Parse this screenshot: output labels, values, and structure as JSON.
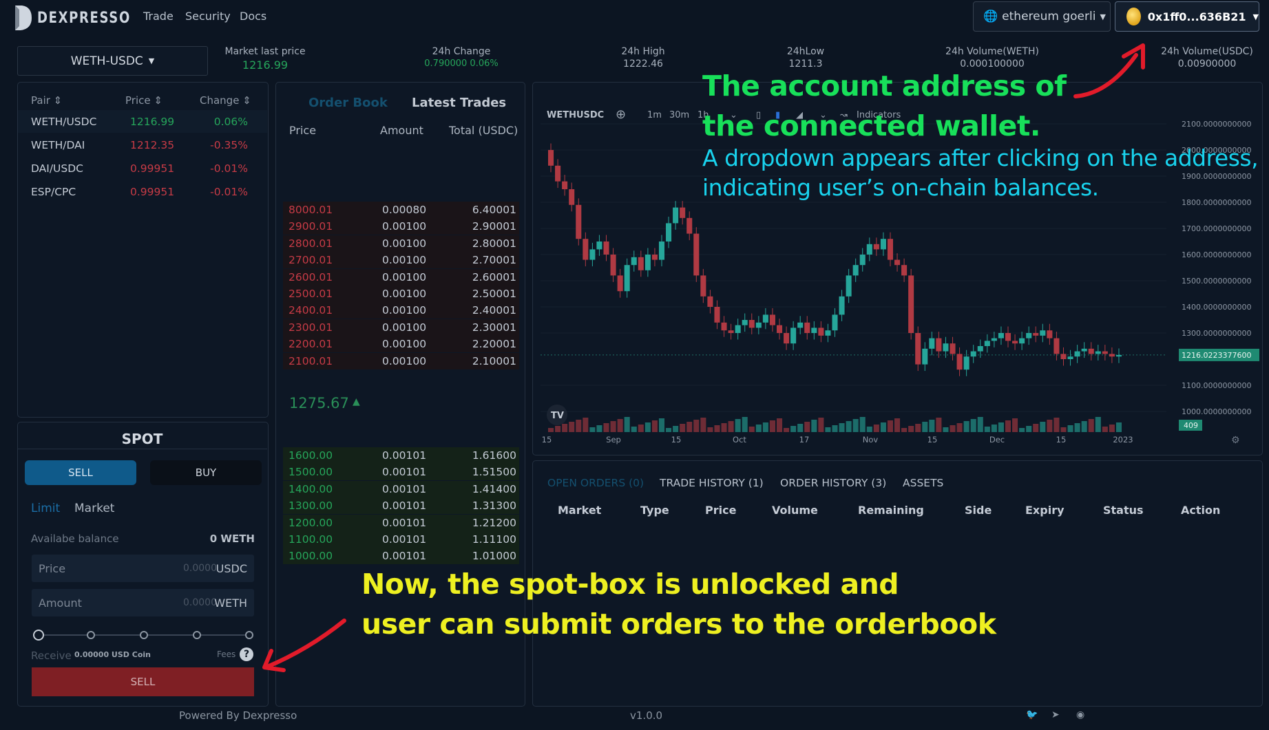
{
  "header": {
    "logo_text": "DEXPRESSO",
    "nav": [
      "Trade",
      "Security",
      "Docs"
    ],
    "network_label": "ethereum goerli",
    "account_label": "0x1ff0...636B21"
  },
  "market": {
    "pair": "WETH-USDC",
    "stats": [
      {
        "label": "Market last price",
        "value": "1216.99"
      },
      {
        "label": "24h Change",
        "value": "0.790000 0.06%"
      },
      {
        "label": "24h High",
        "value": "1222.46"
      },
      {
        "label": "24hLow",
        "value": "1211.3"
      },
      {
        "label": "24h Volume(WETH)",
        "value": "0.000100000"
      },
      {
        "label": "24h Volume(USDC)",
        "value": "0.00900000"
      }
    ]
  },
  "pairs": {
    "headers": [
      "Pair",
      "Price",
      "Change"
    ],
    "rows": [
      {
        "pair": "WETH/USDC",
        "price": "1216.99",
        "change": "0.06%"
      },
      {
        "pair": "WETH/DAI",
        "price": "1212.35",
        "change": "-0.35%"
      },
      {
        "pair": "DAI/USDC",
        "price": "0.99951",
        "change": "-0.01%"
      },
      {
        "pair": "ESP/CPC",
        "price": "0.99951",
        "change": "-0.01%"
      }
    ]
  },
  "spot": {
    "title": "SPOT",
    "sell_tab": "SELL",
    "buy_tab": "BUY",
    "limit": "Limit",
    "market": "Market",
    "balance_label": "Availabe balance",
    "balance_value": "0 WETH",
    "price_label": "Price",
    "price_value": "0.0000",
    "price_unit": "USDC",
    "amount_label": "Amount",
    "amount_value": "0.0000",
    "amount_unit": "WETH",
    "receive_label": "Receive",
    "receive_value": "0.00000 USD Coin",
    "fees_label": "Fees",
    "submit_label": "SELL"
  },
  "orderbook": {
    "tabs": [
      "Order Book",
      "Latest Trades"
    ],
    "headers": [
      "Price",
      "Amount",
      "Total (USDC)"
    ],
    "asks": [
      [
        "8000.01",
        "0.00080",
        "6.40001"
      ],
      [
        "2900.01",
        "0.00100",
        "2.90001"
      ],
      [
        "2800.01",
        "0.00100",
        "2.80001"
      ],
      [
        "2700.01",
        "0.00100",
        "2.70001"
      ],
      [
        "2600.01",
        "0.00100",
        "2.60001"
      ],
      [
        "2500.01",
        "0.00100",
        "2.50001"
      ],
      [
        "2400.01",
        "0.00100",
        "2.40001"
      ],
      [
        "2300.01",
        "0.00100",
        "2.30001"
      ],
      [
        "2200.01",
        "0.00100",
        "2.20001"
      ],
      [
        "2100.01",
        "0.00100",
        "2.10001"
      ]
    ],
    "mid_price": "1275.67",
    "bids": [
      [
        "1600.00",
        "0.00101",
        "1.61600"
      ],
      [
        "1500.00",
        "0.00101",
        "1.51500"
      ],
      [
        "1400.00",
        "0.00101",
        "1.41400"
      ],
      [
        "1300.00",
        "0.00101",
        "1.31300"
      ],
      [
        "1200.00",
        "0.00101",
        "1.21200"
      ],
      [
        "1100.00",
        "0.00101",
        "1.11100"
      ],
      [
        "1000.00",
        "0.00101",
        "1.01000"
      ]
    ]
  },
  "chart_toolbar": {
    "symbol": "WETHUSDC",
    "intervals": [
      "1m",
      "30m",
      "1h"
    ],
    "indicators": "Indicators"
  },
  "chart_data": {
    "type": "candlestick",
    "symbol": "WETHUSDC",
    "y_ticks": [
      "2100.0000000000",
      "2000.0000000000",
      "1900.0000000000",
      "1800.0000000000",
      "1700.0000000000",
      "1600.0000000000",
      "1500.0000000000",
      "1400.0000000000",
      "1300.0000000000",
      "1216.0223377600",
      "1100.0000000000",
      "1000.0000000000"
    ],
    "x_ticks": [
      "15",
      "Sep",
      "15",
      "Oct",
      "17",
      "Nov",
      "15",
      "Dec",
      "15",
      "2023"
    ],
    "ylim": [
      1000,
      2100
    ],
    "last_price": "1216.0223377600",
    "volume_label": "409",
    "close_series": [
      1940,
      1880,
      1850,
      1790,
      1660,
      1580,
      1620,
      1650,
      1600,
      1520,
      1460,
      1560,
      1590,
      1540,
      1600,
      1580,
      1650,
      1720,
      1780,
      1740,
      1680,
      1520,
      1440,
      1400,
      1340,
      1310,
      1300,
      1330,
      1350,
      1320,
      1340,
      1370,
      1330,
      1300,
      1260,
      1320,
      1340,
      1300,
      1320,
      1290,
      1310,
      1370,
      1440,
      1520,
      1560,
      1600,
      1640,
      1620,
      1660,
      1580,
      1560,
      1520,
      1300,
      1180,
      1240,
      1280,
      1230,
      1260,
      1220,
      1160,
      1210,
      1230,
      1250,
      1270,
      1280,
      1300,
      1270,
      1260,
      1280,
      1300,
      1290,
      1310,
      1280,
      1220,
      1200,
      1210,
      1230,
      1240,
      1220,
      1230,
      1220,
      1210,
      1216
    ],
    "colors": {
      "up": "#26a69a",
      "down": "#b03a43"
    }
  },
  "orders": {
    "tabs": [
      "OPEN ORDERS (0)",
      "TRADE HISTORY (1)",
      "ORDER HISTORY (3)",
      "ASSETS"
    ],
    "columns": [
      "Market",
      "Type",
      "Price",
      "Volume",
      "Remaining",
      "Side",
      "Expiry",
      "Status",
      "Action"
    ]
  },
  "footer": {
    "powered": "Powered By Dexpresso",
    "version": "v1.0.0"
  },
  "annotations": {
    "account_title_line1": "The account address of",
    "account_title_line2": "the connected wallet.",
    "account_desc_line1": "A dropdown appears after clicking on the address,",
    "account_desc_line2": "indicating user’s on-chain balances.",
    "spot_line1": "Now, the spot-box is unlocked and",
    "spot_line2": "user can submit orders to the orderbook"
  },
  "colors": {
    "background": "#0c1522",
    "accent_blue": "#0f5a8a",
    "sell_red": "#7f1f24",
    "up_green": "#26a65b",
    "annotation_green": "#18e05a",
    "annotation_cyan": "#19d3ee",
    "annotation_yellow": "#eef021",
    "arrow_red": "#e21b2a"
  }
}
